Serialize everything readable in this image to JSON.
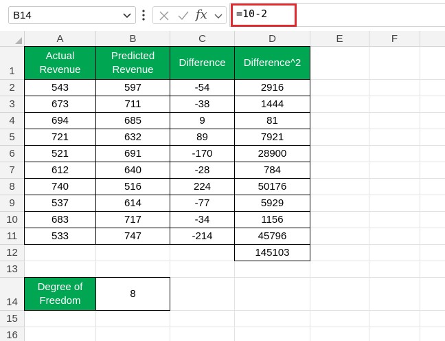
{
  "formula_bar": {
    "name_box": "B14",
    "formula": "=10-2",
    "fx_label": "fx"
  },
  "columns": [
    "A",
    "B",
    "C",
    "D",
    "E",
    "F"
  ],
  "rows": [
    "1",
    "2",
    "3",
    "4",
    "5",
    "6",
    "7",
    "8",
    "9",
    "10",
    "11",
    "12",
    "13",
    "14",
    "15",
    "16"
  ],
  "table": {
    "headers": [
      "Actual\nRevenue",
      "Predicted\nRevenue",
      "Difference",
      "Difference^2"
    ],
    "data": [
      [
        "543",
        "597",
        "-54",
        "2916"
      ],
      [
        "673",
        "711",
        "-38",
        "1444"
      ],
      [
        "694",
        "685",
        "9",
        "81"
      ],
      [
        "721",
        "632",
        "89",
        "7921"
      ],
      [
        "521",
        "691",
        "-170",
        "28900"
      ],
      [
        "612",
        "640",
        "-28",
        "784"
      ],
      [
        "740",
        "516",
        "224",
        "50176"
      ],
      [
        "537",
        "614",
        "-77",
        "5929"
      ],
      [
        "683",
        "717",
        "-34",
        "1156"
      ],
      [
        "533",
        "747",
        "-214",
        "45796"
      ]
    ],
    "sum": "145103"
  },
  "dof": {
    "label": "Degree of\nFreedom",
    "value": "8"
  },
  "colors": {
    "header_green": "#00a651",
    "highlight_red": "#e0282e"
  }
}
